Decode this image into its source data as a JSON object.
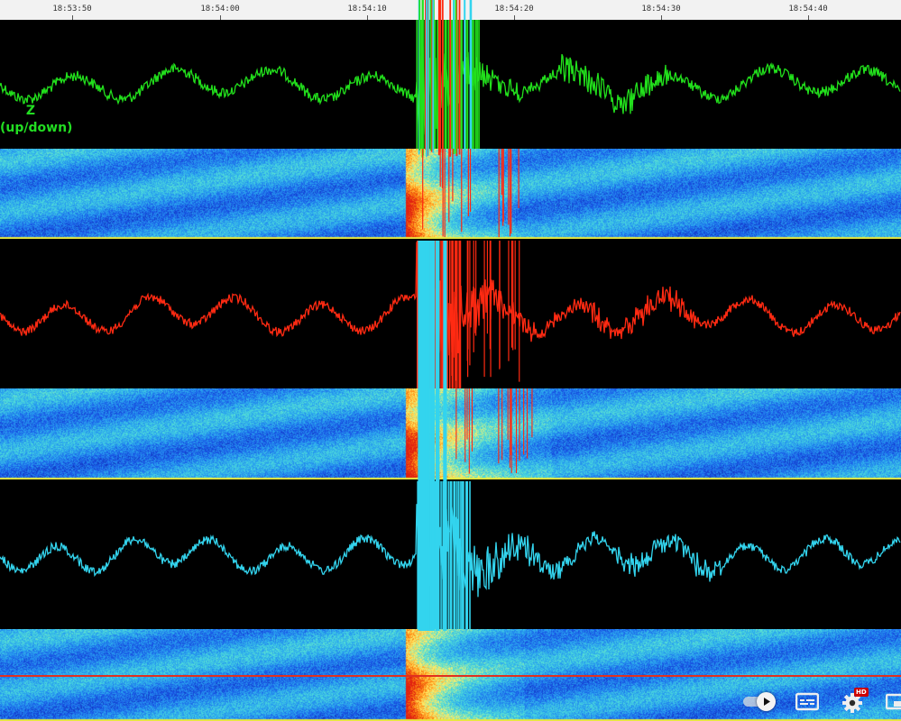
{
  "viewer": {
    "time_axis": {
      "tick_labels": [
        "18:53:50",
        "18:54:00",
        "18:54:10",
        "18:54:20",
        "18:54:30",
        "18:54:40"
      ]
    },
    "channels": [
      {
        "id": "z",
        "label_line1": "Z",
        "label_line2": "(up/down)",
        "trace_color": "#22e01c"
      },
      {
        "id": "n",
        "trace_color": "#ff2a12"
      },
      {
        "id": "e",
        "trace_color": "#33d4ee"
      }
    ],
    "spectrogram_colors": [
      "#0a1a9a",
      "#1a58e8",
      "#2aa6f0",
      "#52e0d8",
      "#fff06a",
      "#ff8a10",
      "#e02010"
    ],
    "divider_color": "#e03020"
  },
  "player_controls": {
    "autoplay_icon": "autoplay-toggle-icon",
    "subtitles_icon": "subtitles-icon",
    "settings_icon": "gear-icon",
    "hd_badge": "HD",
    "miniplayer_icon": "miniplayer-icon"
  }
}
